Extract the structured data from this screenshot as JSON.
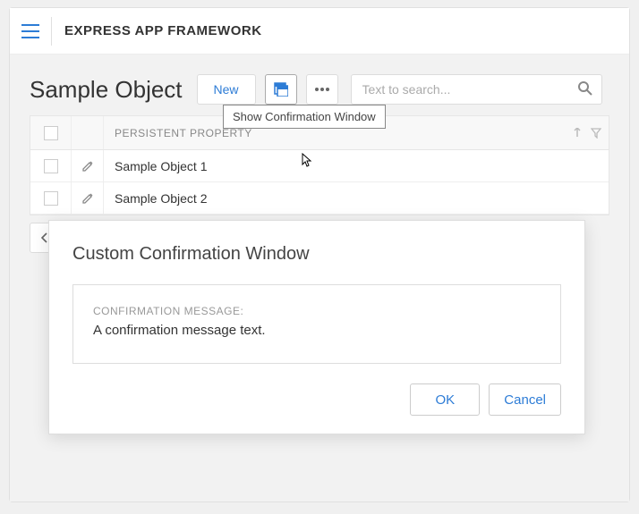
{
  "header": {
    "app_title": "EXPRESS APP FRAMEWORK"
  },
  "page": {
    "title": "Sample Object"
  },
  "toolbar": {
    "new_label": "New",
    "tooltip": "Show Confirmation Window",
    "search_placeholder": "Text to search..."
  },
  "grid": {
    "column_header": "PERSISTENT PROPERTY",
    "rows": [
      {
        "name": "Sample Object 1"
      },
      {
        "name": "Sample Object 2"
      }
    ]
  },
  "modal": {
    "title": "Custom Confirmation Window",
    "message_label": "CONFIRMATION MESSAGE:",
    "message_text": "A confirmation message text.",
    "ok_label": "OK",
    "cancel_label": "Cancel"
  }
}
